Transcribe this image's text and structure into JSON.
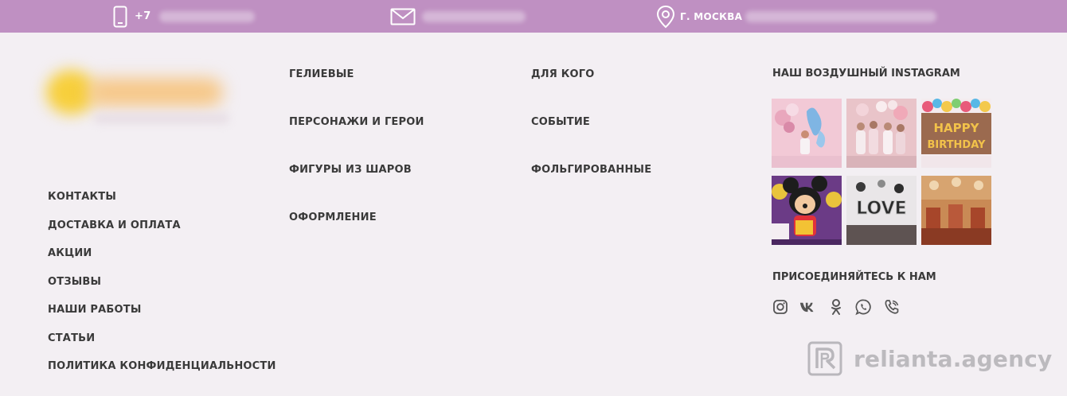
{
  "topbar": {
    "phone_prefix": "+7",
    "city": "Г. МОСКВА",
    "phone_icon": "phone-icon",
    "mail_icon": "mail-icon",
    "location_icon": "location-pin-icon",
    "background": "#bf90c2"
  },
  "footer": {
    "col1": [
      "КОНТАКТЫ",
      "ДОСТАВКА И ОПЛАТА",
      "АКЦИИ",
      "ОТЗЫВЫ",
      "НАШИ РАБОТЫ",
      "СТАТЬИ",
      "ПОЛИТИКА КОНФИДЕНЦИАЛЬНОСТИ"
    ],
    "col2": [
      "ГЕЛИЕВЫЕ",
      "ПЕРСОНАЖИ И ГЕРОИ",
      "ФИГУРЫ ИЗ ШАРОВ",
      "ОФОРМЛЕНИЕ"
    ],
    "col3": [
      "ДЛЯ КОГО",
      "СОБЫТИЕ",
      "ФОЛЬГИРОВАННЫЕ"
    ],
    "instagram_title": "НАШ ВОЗДУШНЫЙ INSTAGRAM",
    "join_title": "ПРИСОЕДИНЯЙТЕСЬ К НАМ",
    "socials": [
      "instagram-icon",
      "vk-icon",
      "odnoklassniki-icon",
      "whatsapp-icon",
      "viber-icon"
    ]
  },
  "instagram_tiles": {
    "tile1_text": "",
    "tile3_text": "HAPPY BIRTHDAY",
    "tile5_text": "LOVE"
  },
  "watermark": "relianta.agency"
}
